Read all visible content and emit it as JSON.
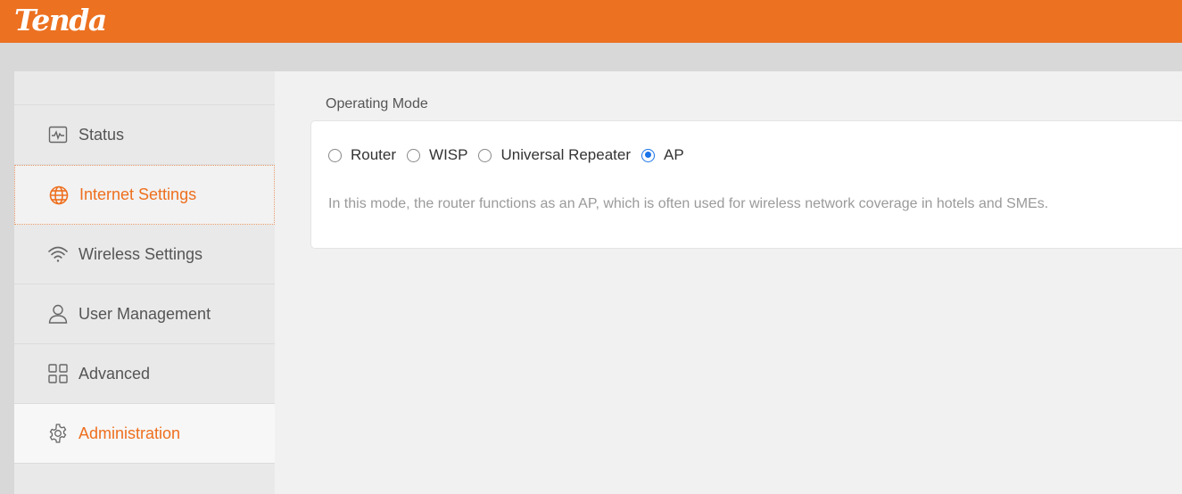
{
  "brand": {
    "logo_text": "Tenda",
    "accent": "#ec7121"
  },
  "sidebar": {
    "items": [
      {
        "label": "Status",
        "icon": "activity-monitor-icon"
      },
      {
        "label": "Internet Settings",
        "icon": "globe-icon"
      },
      {
        "label": "Wireless Settings",
        "icon": "wifi-icon"
      },
      {
        "label": "User Management",
        "icon": "user-icon"
      },
      {
        "label": "Advanced",
        "icon": "grid-icon"
      },
      {
        "label": "Administration",
        "icon": "gear-icon"
      }
    ]
  },
  "main": {
    "section_title": "Operating Mode",
    "modes": [
      {
        "label": "Router",
        "checked": false
      },
      {
        "label": "WISP",
        "checked": false
      },
      {
        "label": "Universal Repeater",
        "checked": false
      },
      {
        "label": "AP",
        "checked": true
      }
    ],
    "description": "In this mode, the router functions as an AP, which is often used for wireless network coverage in hotels and SMEs."
  }
}
